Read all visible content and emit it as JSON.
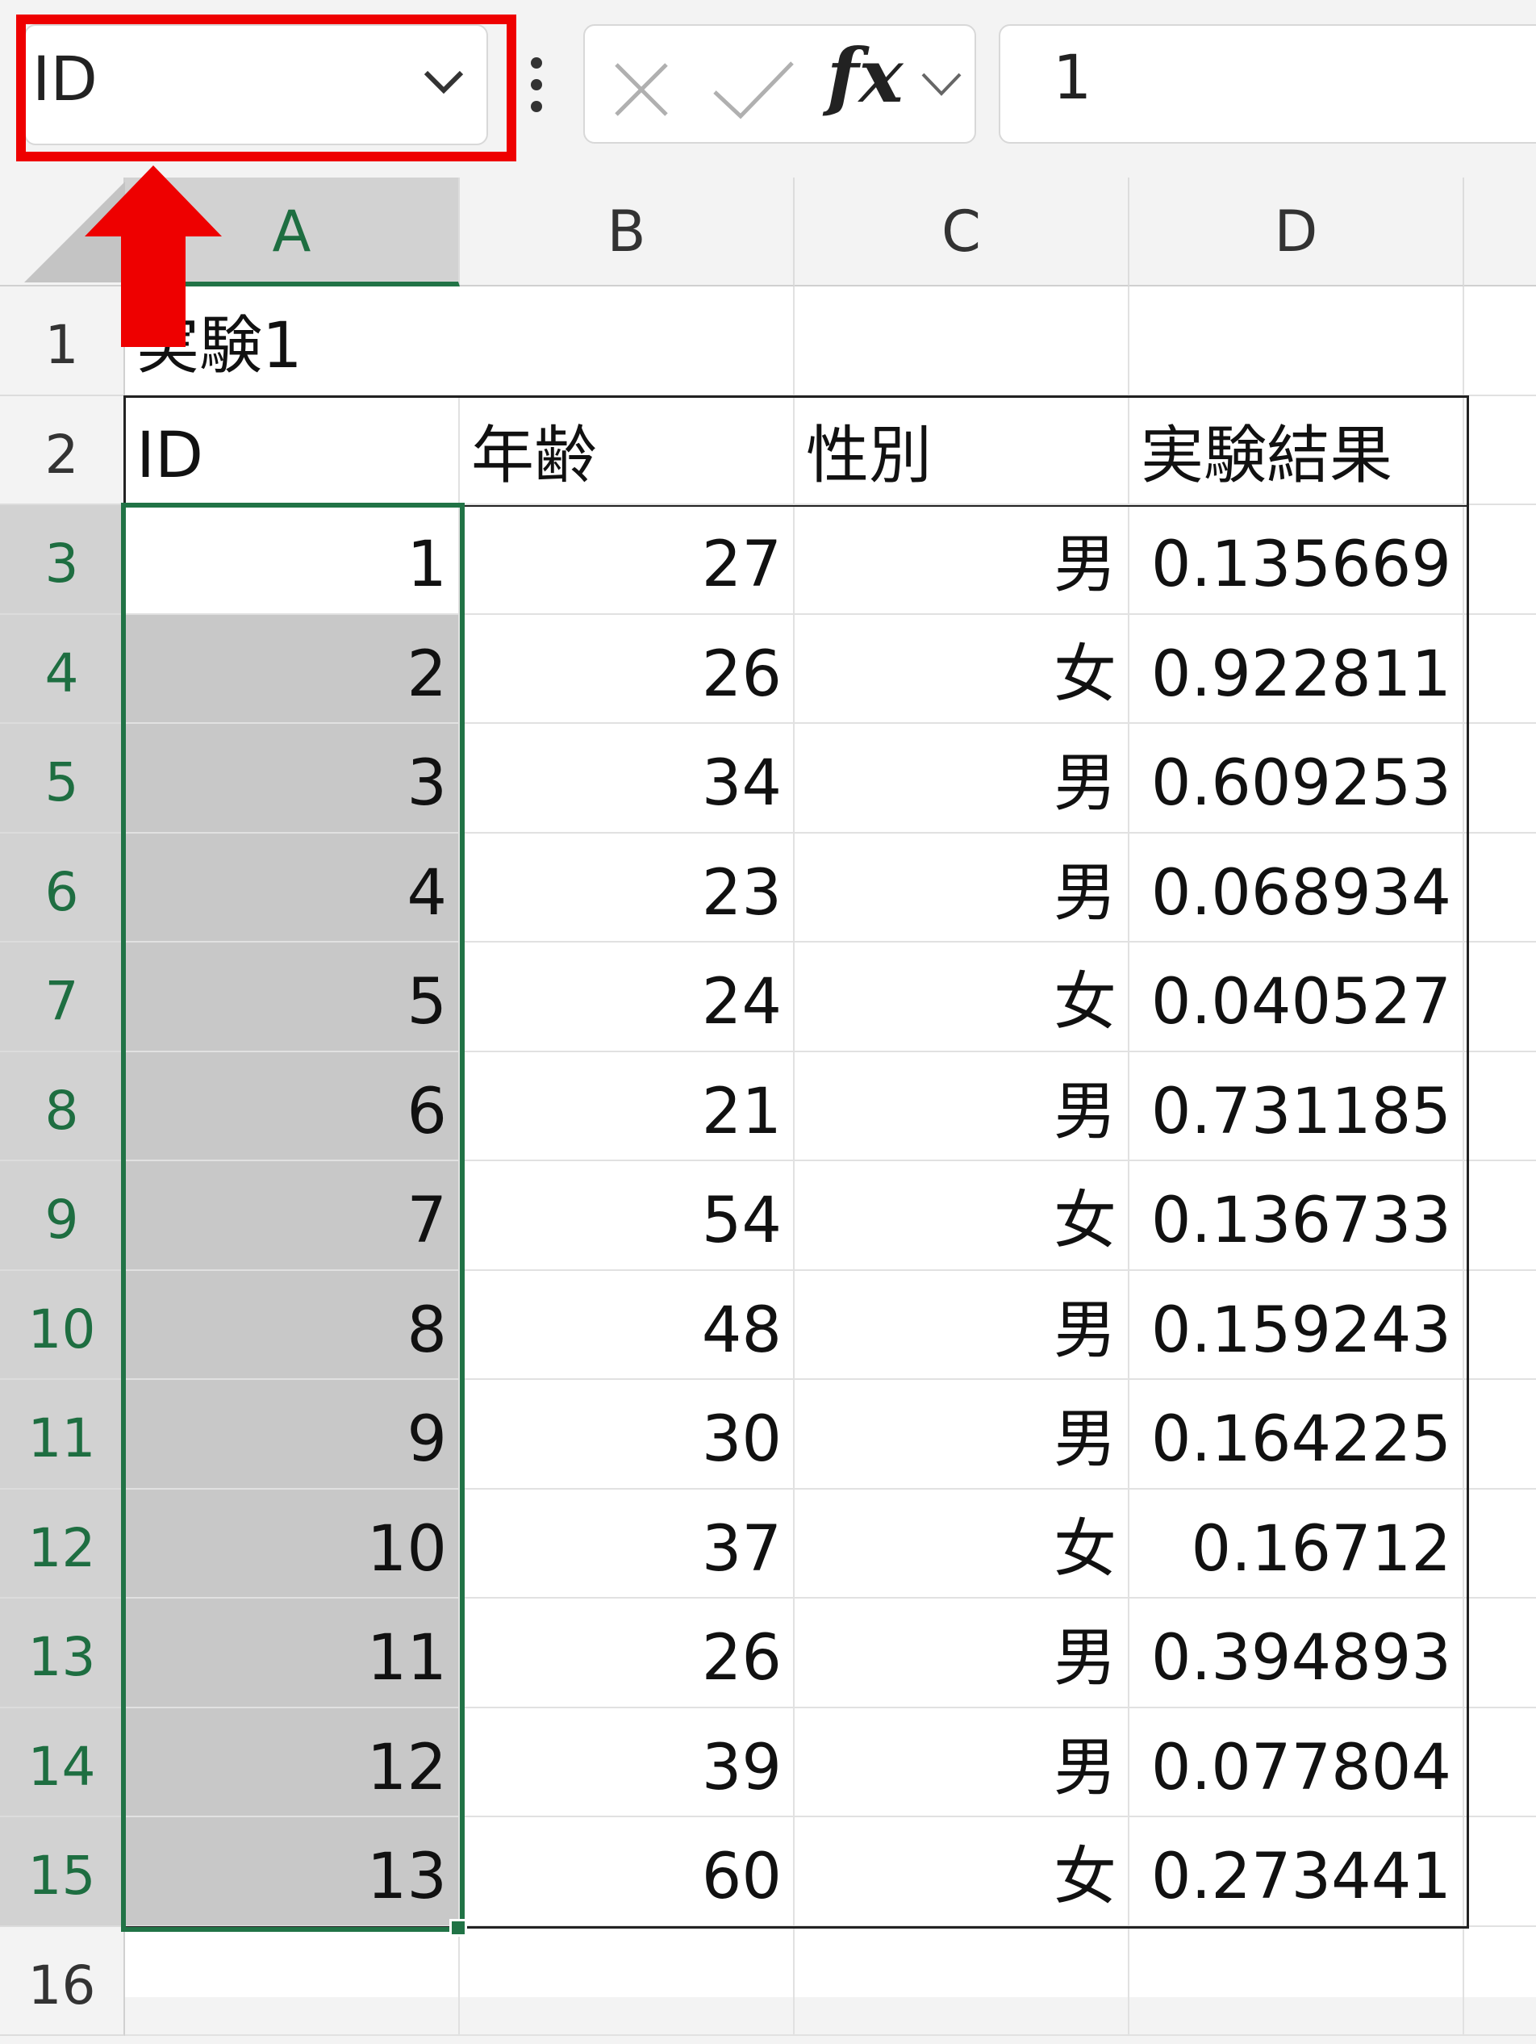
{
  "name_box": {
    "value": "ID"
  },
  "formula_bar": {
    "fx_label": "fx",
    "value": "1"
  },
  "columns": [
    "A",
    "B",
    "C",
    "D"
  ],
  "selected_column": "A",
  "rows": [
    {
      "n": "1",
      "A": "実験1",
      "B": "",
      "C": "",
      "D": ""
    },
    {
      "n": "2",
      "A": "ID",
      "B": "年齢",
      "C": "性別",
      "D": "実験結果"
    },
    {
      "n": "3",
      "A": "1",
      "B": "27",
      "C": "男",
      "D": "0.135669"
    },
    {
      "n": "4",
      "A": "2",
      "B": "26",
      "C": "女",
      "D": "0.922811"
    },
    {
      "n": "5",
      "A": "3",
      "B": "34",
      "C": "男",
      "D": "0.609253"
    },
    {
      "n": "6",
      "A": "4",
      "B": "23",
      "C": "男",
      "D": "0.068934"
    },
    {
      "n": "7",
      "A": "5",
      "B": "24",
      "C": "女",
      "D": "0.040527"
    },
    {
      "n": "8",
      "A": "6",
      "B": "21",
      "C": "男",
      "D": "0.731185"
    },
    {
      "n": "9",
      "A": "7",
      "B": "54",
      "C": "女",
      "D": "0.136733"
    },
    {
      "n": "10",
      "A": "8",
      "B": "48",
      "C": "男",
      "D": "0.159243"
    },
    {
      "n": "11",
      "A": "9",
      "B": "30",
      "C": "男",
      "D": "0.164225"
    },
    {
      "n": "12",
      "A": "10",
      "B": "37",
      "C": "女",
      "D": "0.16712"
    },
    {
      "n": "13",
      "A": "11",
      "B": "26",
      "C": "男",
      "D": "0.394893"
    },
    {
      "n": "14",
      "A": "12",
      "B": "39",
      "C": "男",
      "D": "0.077804"
    },
    {
      "n": "15",
      "A": "13",
      "B": "60",
      "C": "女",
      "D": "0.273441"
    },
    {
      "n": "16",
      "A": "",
      "B": "",
      "C": "",
      "D": ""
    }
  ],
  "colors": {
    "accent_green": "#217346",
    "selection_fill": "#c8c8c8",
    "highlight_red": "#ee0000"
  }
}
